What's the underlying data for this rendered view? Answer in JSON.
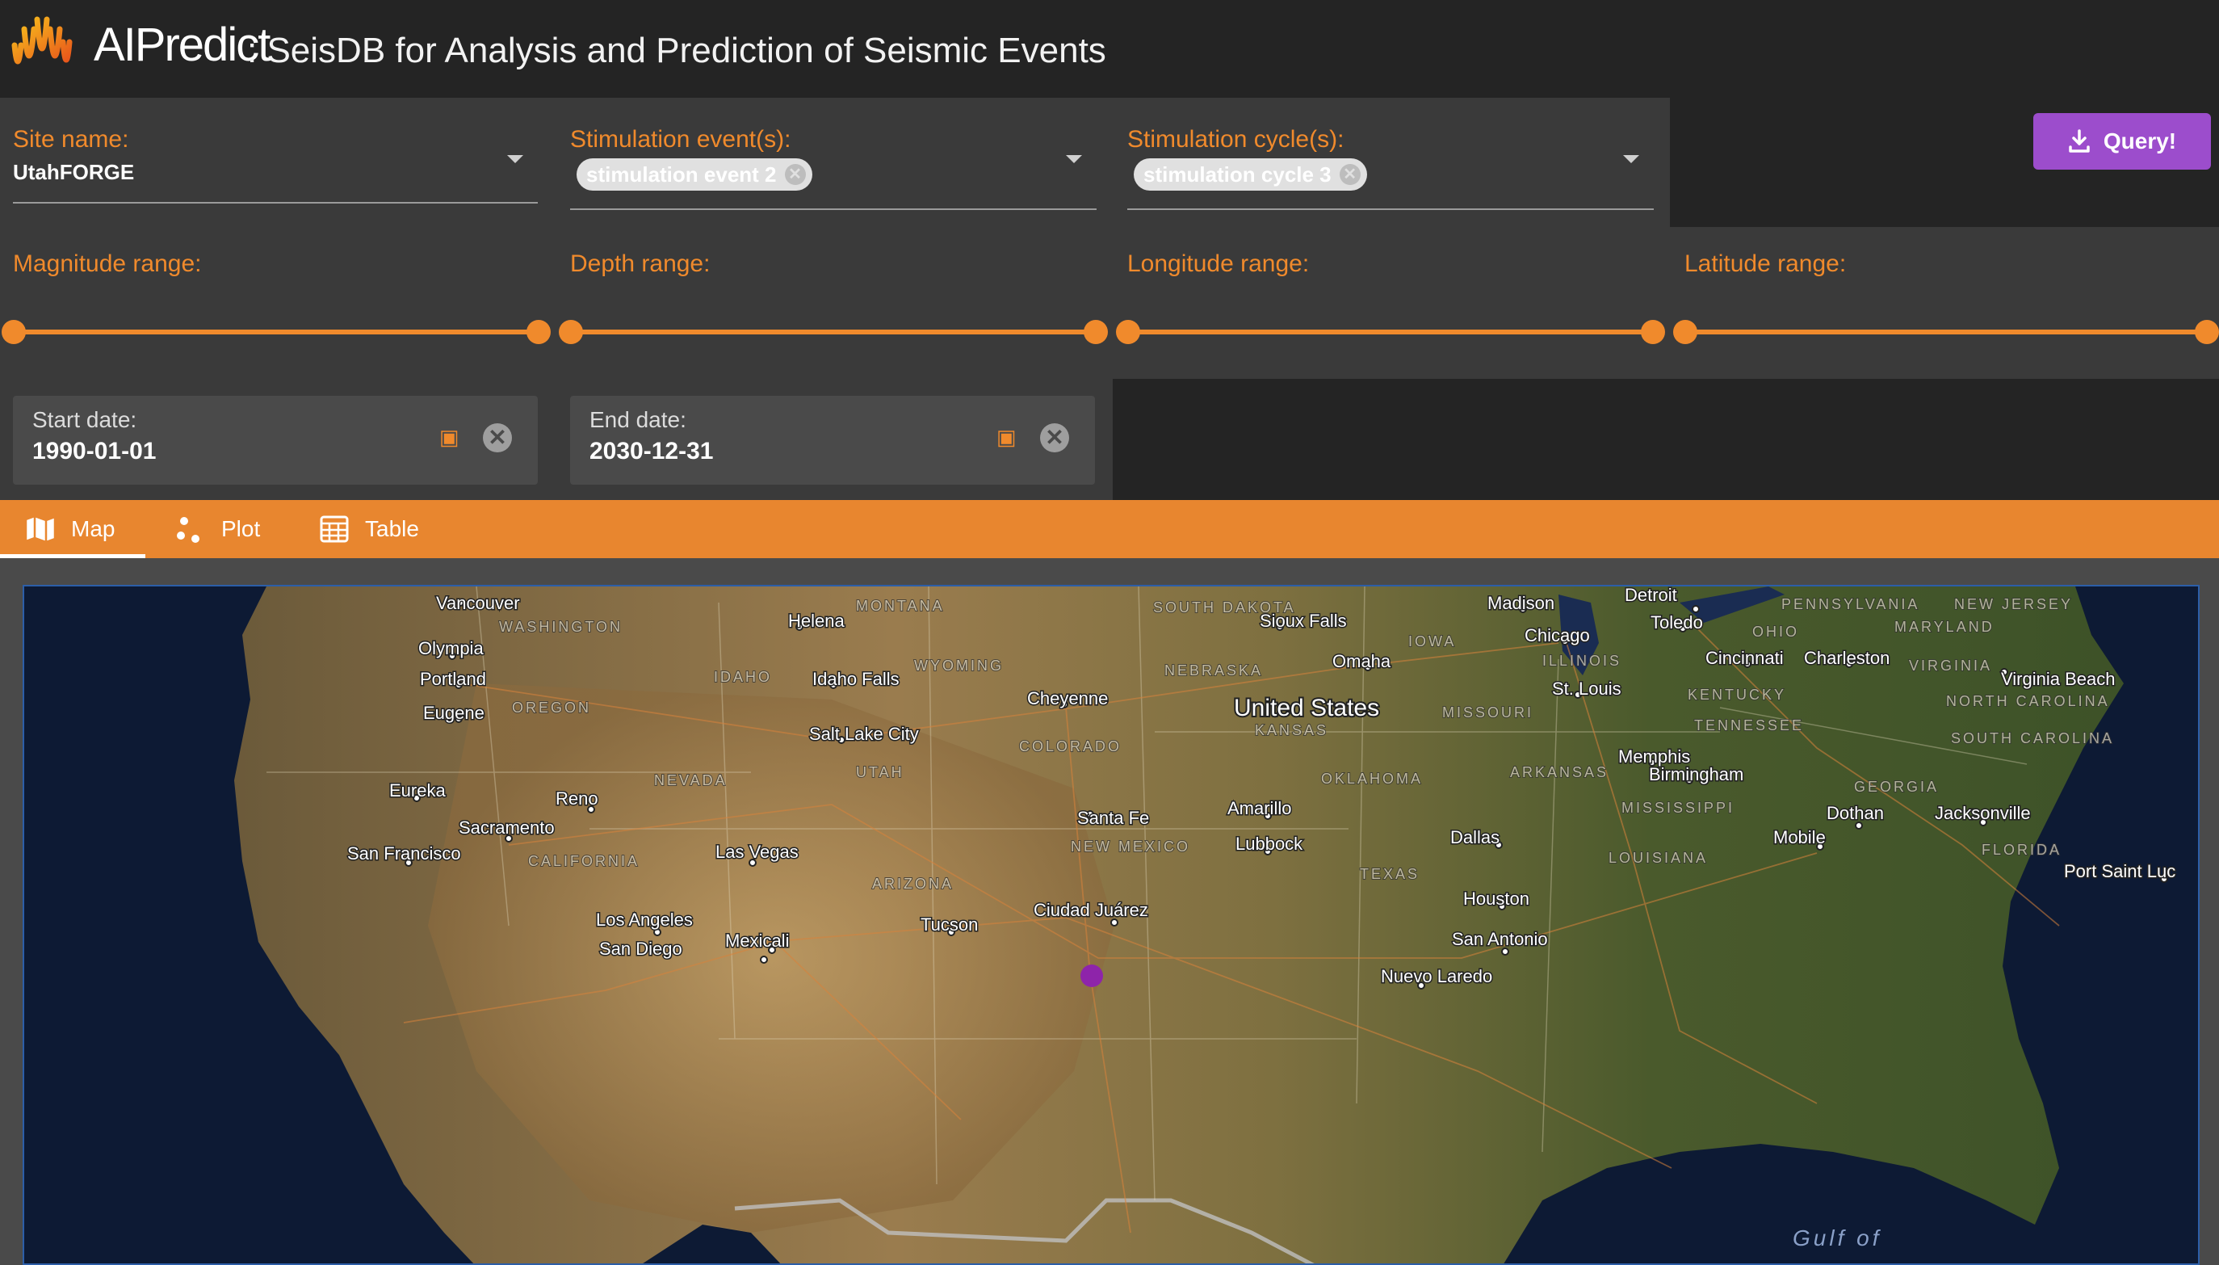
{
  "header": {
    "logo_word": "AIPredict",
    "title": ": SeisDB for Analysis and Prediction of Seismic Events"
  },
  "filters": {
    "site": {
      "label": "Site name:",
      "value": "UtahFORGE"
    },
    "events": {
      "label": "Stimulation event(s):",
      "chips": [
        "stimulation event 2"
      ]
    },
    "cycles": {
      "label": "Stimulation cycle(s):",
      "chips": [
        "stimulation cycle 3"
      ]
    },
    "query_label": "Query!",
    "ranges": {
      "magnitude": "Magnitude range:",
      "depth": "Depth range:",
      "longitude": "Longitude range:",
      "latitude": "Latitude range:"
    },
    "start_date": {
      "label": "Start date:",
      "value": "1990-01-01"
    },
    "end_date": {
      "label": "End date:",
      "value": "2030-12-31"
    }
  },
  "tabs": [
    {
      "label": "Map",
      "icon": "map-icon",
      "active": true
    },
    {
      "label": "Plot",
      "icon": "scatter-icon",
      "active": false
    },
    {
      "label": "Table",
      "icon": "table-icon",
      "active": false
    }
  ],
  "map": {
    "country": "United States",
    "water": "Gulf of",
    "cities": [
      "Vancouver",
      "Helena",
      "Madison",
      "Detroit",
      "Toledo",
      "Sioux Falls",
      "Chicago",
      "Olympia",
      "Omaha",
      "Cincinnati",
      "Charleston",
      "Portland",
      "Idaho Falls",
      "Virginia Beach",
      "St. Louis",
      "Cheyenne",
      "Eugene",
      "Salt Lake City",
      "Memphis",
      "Birmingham",
      "Eureka",
      "Reno",
      "Amarillo",
      "Santa Fe",
      "Jacksonville",
      "Dothan",
      "Sacramento",
      "Dallas",
      "Mobile",
      "Lubbock",
      "San Francisco",
      "Las Vegas",
      "Port Saint Luc",
      "Houston",
      "Ciudad Juárez",
      "Los Angeles",
      "Tucson",
      "San Antonio",
      "Mexicali",
      "San Diego",
      "Nuevo Laredo"
    ],
    "states": [
      "MONTANA",
      "SOUTH DAKOTA",
      "WASHINGTON",
      "PENNSYLVANIA",
      "NEW JERSEY",
      "MARYLAND",
      "IOWA",
      "OHIO",
      "ILLINOIS",
      "VIRGINIA",
      "WYOMING",
      "IDAHO",
      "NEBRASKA",
      "OREGON",
      "KENTUCKY",
      "MISSOURI",
      "NORTH CAROLINA",
      "KANSAS",
      "TENNESSEE",
      "COLORADO",
      "SOUTH CAROLINA",
      "UTAH",
      "NEVADA",
      "ARKANSAS",
      "OKLAHOMA",
      "GEORGIA",
      "MISSISSIPPI",
      "NEW MEXICO",
      "CALIFORNIA",
      "LOUISIANA",
      "FLORIDA",
      "ARIZONA",
      "TEXAS"
    ],
    "colors": {
      "event_marker": "#8e24aa",
      "accent": "#f08a2c",
      "query": "#9c4dcc"
    }
  }
}
